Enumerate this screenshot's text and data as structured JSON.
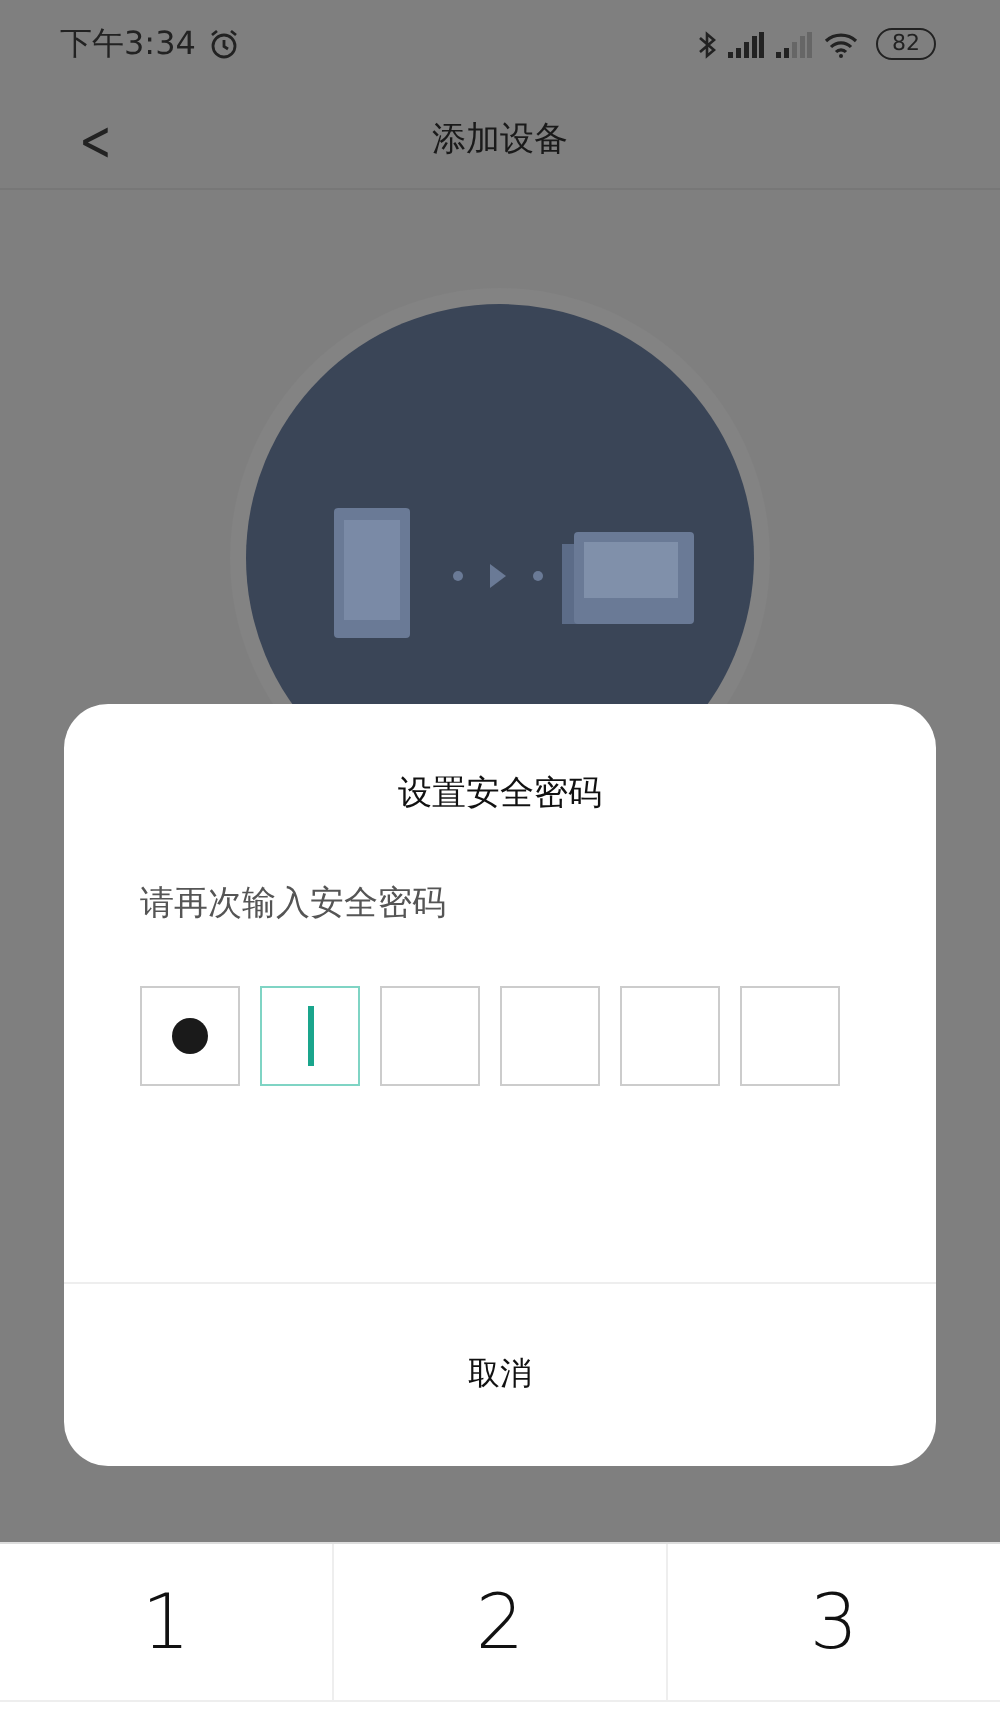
{
  "status_bar": {
    "time": "下午3:34",
    "battery": "82"
  },
  "nav": {
    "back": "<",
    "title": "添加设备"
  },
  "dialog": {
    "title": "设置安全密码",
    "prompt": "请再次输入安全密码",
    "pin_boxes": [
      {
        "filled": true,
        "selected": false
      },
      {
        "filled": false,
        "selected": true
      },
      {
        "filled": false,
        "selected": false
      },
      {
        "filled": false,
        "selected": false
      },
      {
        "filled": false,
        "selected": false
      },
      {
        "filled": false,
        "selected": false
      }
    ],
    "cancel": "取消"
  },
  "keypad": {
    "keys": [
      "1",
      "2",
      "3"
    ]
  }
}
